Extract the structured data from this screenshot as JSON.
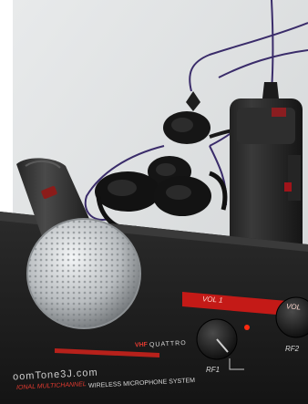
{
  "receiver": {
    "brand_url": "oomTone3J.com",
    "model_prefix": "VHF",
    "model_name": "QUATTRO",
    "description_left": "IONAL MULTICHANNEL",
    "description_right": "WIRELESS MICROPHONE SYSTEM",
    "vol_label_1": "VOL 1",
    "vol_label_2": "VOL",
    "rf_label_1": "RF1",
    "rf_label_2": "RF2"
  },
  "colors": {
    "background": "#d9dcdd",
    "receiver_body": "#1c1c1c",
    "accent_red": "#c41a17",
    "vol_text": "#e23a30",
    "cable_purple": "#3a2c6a",
    "led": "#ff2a10"
  }
}
